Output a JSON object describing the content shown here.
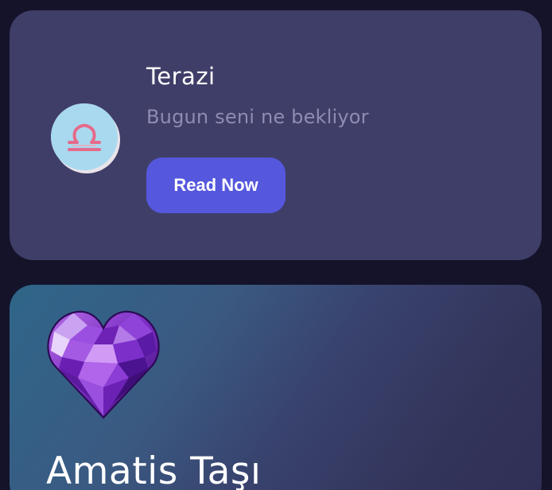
{
  "zodiac_card": {
    "title": "Terazi",
    "subtitle": "Bugun seni ne bekliyor",
    "button_label": "Read Now",
    "icon": "libra-icon"
  },
  "stone_card": {
    "title": "Amatis Taşı",
    "icon": "amethyst-heart-icon"
  },
  "colors": {
    "background": "#14132a",
    "card": "#3f3e68",
    "button": "#5558dd",
    "subtitle": "#8f8cb3",
    "libra_badge": "#a9d9ef",
    "libra_symbol": "#e56b8a"
  }
}
